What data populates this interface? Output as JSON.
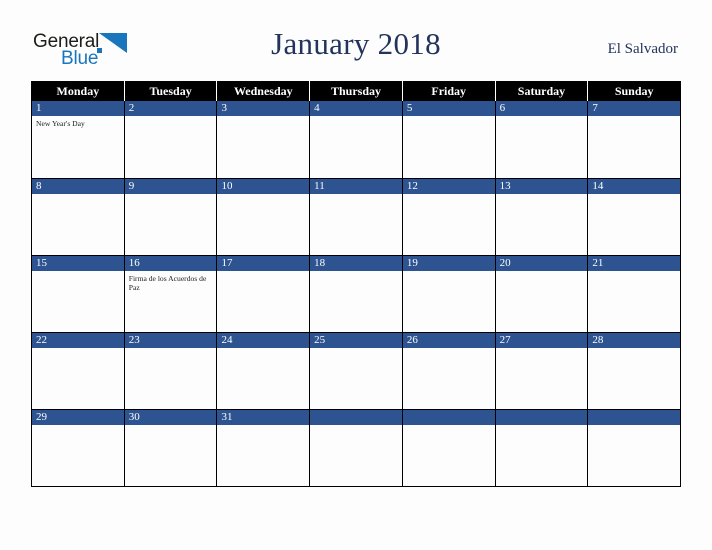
{
  "brand": {
    "name_part1": "General",
    "name_part2": "Blue",
    "mark_icon": "triangle-mark-icon",
    "color_dark": "#1d1d1b",
    "color_blue": "#1a76bc"
  },
  "header": {
    "title": "January 2018",
    "country": "El Salvador",
    "title_color": "#23345c"
  },
  "calendar": {
    "weekday_headers": [
      "Monday",
      "Tuesday",
      "Wednesday",
      "Thursday",
      "Friday",
      "Saturday",
      "Sunday"
    ],
    "header_bg": "#000000",
    "header_text_color": "#ffffff",
    "date_band_bg": "#2d5490",
    "date_text_color": "#ffffff",
    "grid_border_color": "#000000",
    "weeks": [
      [
        {
          "date": "1",
          "events": [
            "New Year's Day"
          ]
        },
        {
          "date": "2",
          "events": []
        },
        {
          "date": "3",
          "events": []
        },
        {
          "date": "4",
          "events": []
        },
        {
          "date": "5",
          "events": []
        },
        {
          "date": "6",
          "events": []
        },
        {
          "date": "7",
          "events": []
        }
      ],
      [
        {
          "date": "8",
          "events": []
        },
        {
          "date": "9",
          "events": []
        },
        {
          "date": "10",
          "events": []
        },
        {
          "date": "11",
          "events": []
        },
        {
          "date": "12",
          "events": []
        },
        {
          "date": "13",
          "events": []
        },
        {
          "date": "14",
          "events": []
        }
      ],
      [
        {
          "date": "15",
          "events": []
        },
        {
          "date": "16",
          "events": [
            "Firma de los Acuerdos de Paz"
          ]
        },
        {
          "date": "17",
          "events": []
        },
        {
          "date": "18",
          "events": []
        },
        {
          "date": "19",
          "events": []
        },
        {
          "date": "20",
          "events": []
        },
        {
          "date": "21",
          "events": []
        }
      ],
      [
        {
          "date": "22",
          "events": []
        },
        {
          "date": "23",
          "events": []
        },
        {
          "date": "24",
          "events": []
        },
        {
          "date": "25",
          "events": []
        },
        {
          "date": "26",
          "events": []
        },
        {
          "date": "27",
          "events": []
        },
        {
          "date": "28",
          "events": []
        }
      ],
      [
        {
          "date": "29",
          "events": []
        },
        {
          "date": "30",
          "events": []
        },
        {
          "date": "31",
          "events": []
        },
        {
          "date": "",
          "events": []
        },
        {
          "date": "",
          "events": []
        },
        {
          "date": "",
          "events": []
        },
        {
          "date": "",
          "events": []
        }
      ]
    ]
  }
}
